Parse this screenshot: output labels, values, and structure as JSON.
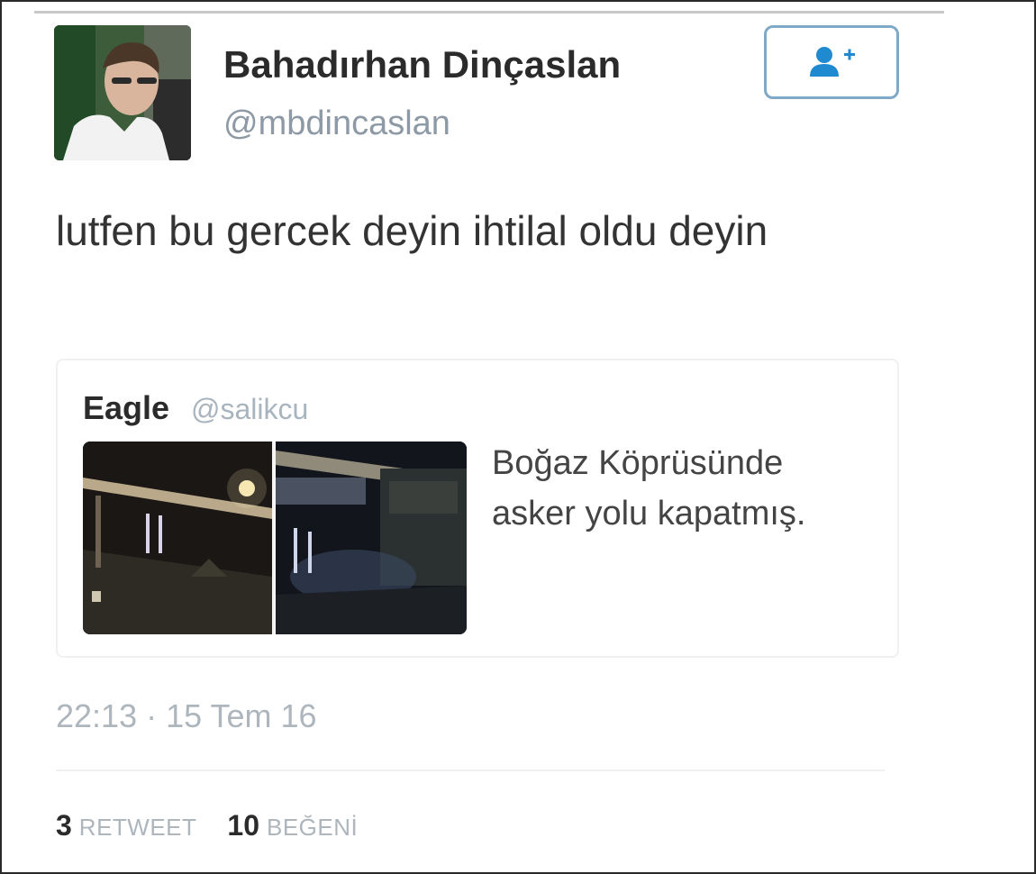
{
  "tweet": {
    "author": {
      "name": "Bahadırhan Dinçaslan",
      "handle": "@mbdincaslan",
      "avatar_icon": "profile-photo"
    },
    "follow_button": {
      "icon": "add-user-icon",
      "color": "#1f8ad0"
    },
    "text": "lutfen bu gercek deyin ihtilal oldu deyin",
    "quoted": {
      "name": "Eagle",
      "handle": "@salikcu",
      "text": "Boğaz Köprüsünde asker yolu kapatmış.",
      "media_icon": "night-bridge-photos"
    },
    "timestamp": "22:13 · 15 Tem 16",
    "stats": {
      "retweet_count": "3",
      "retweet_label": "RETWEET",
      "like_count": "10",
      "like_label": "BEĞENİ"
    }
  }
}
